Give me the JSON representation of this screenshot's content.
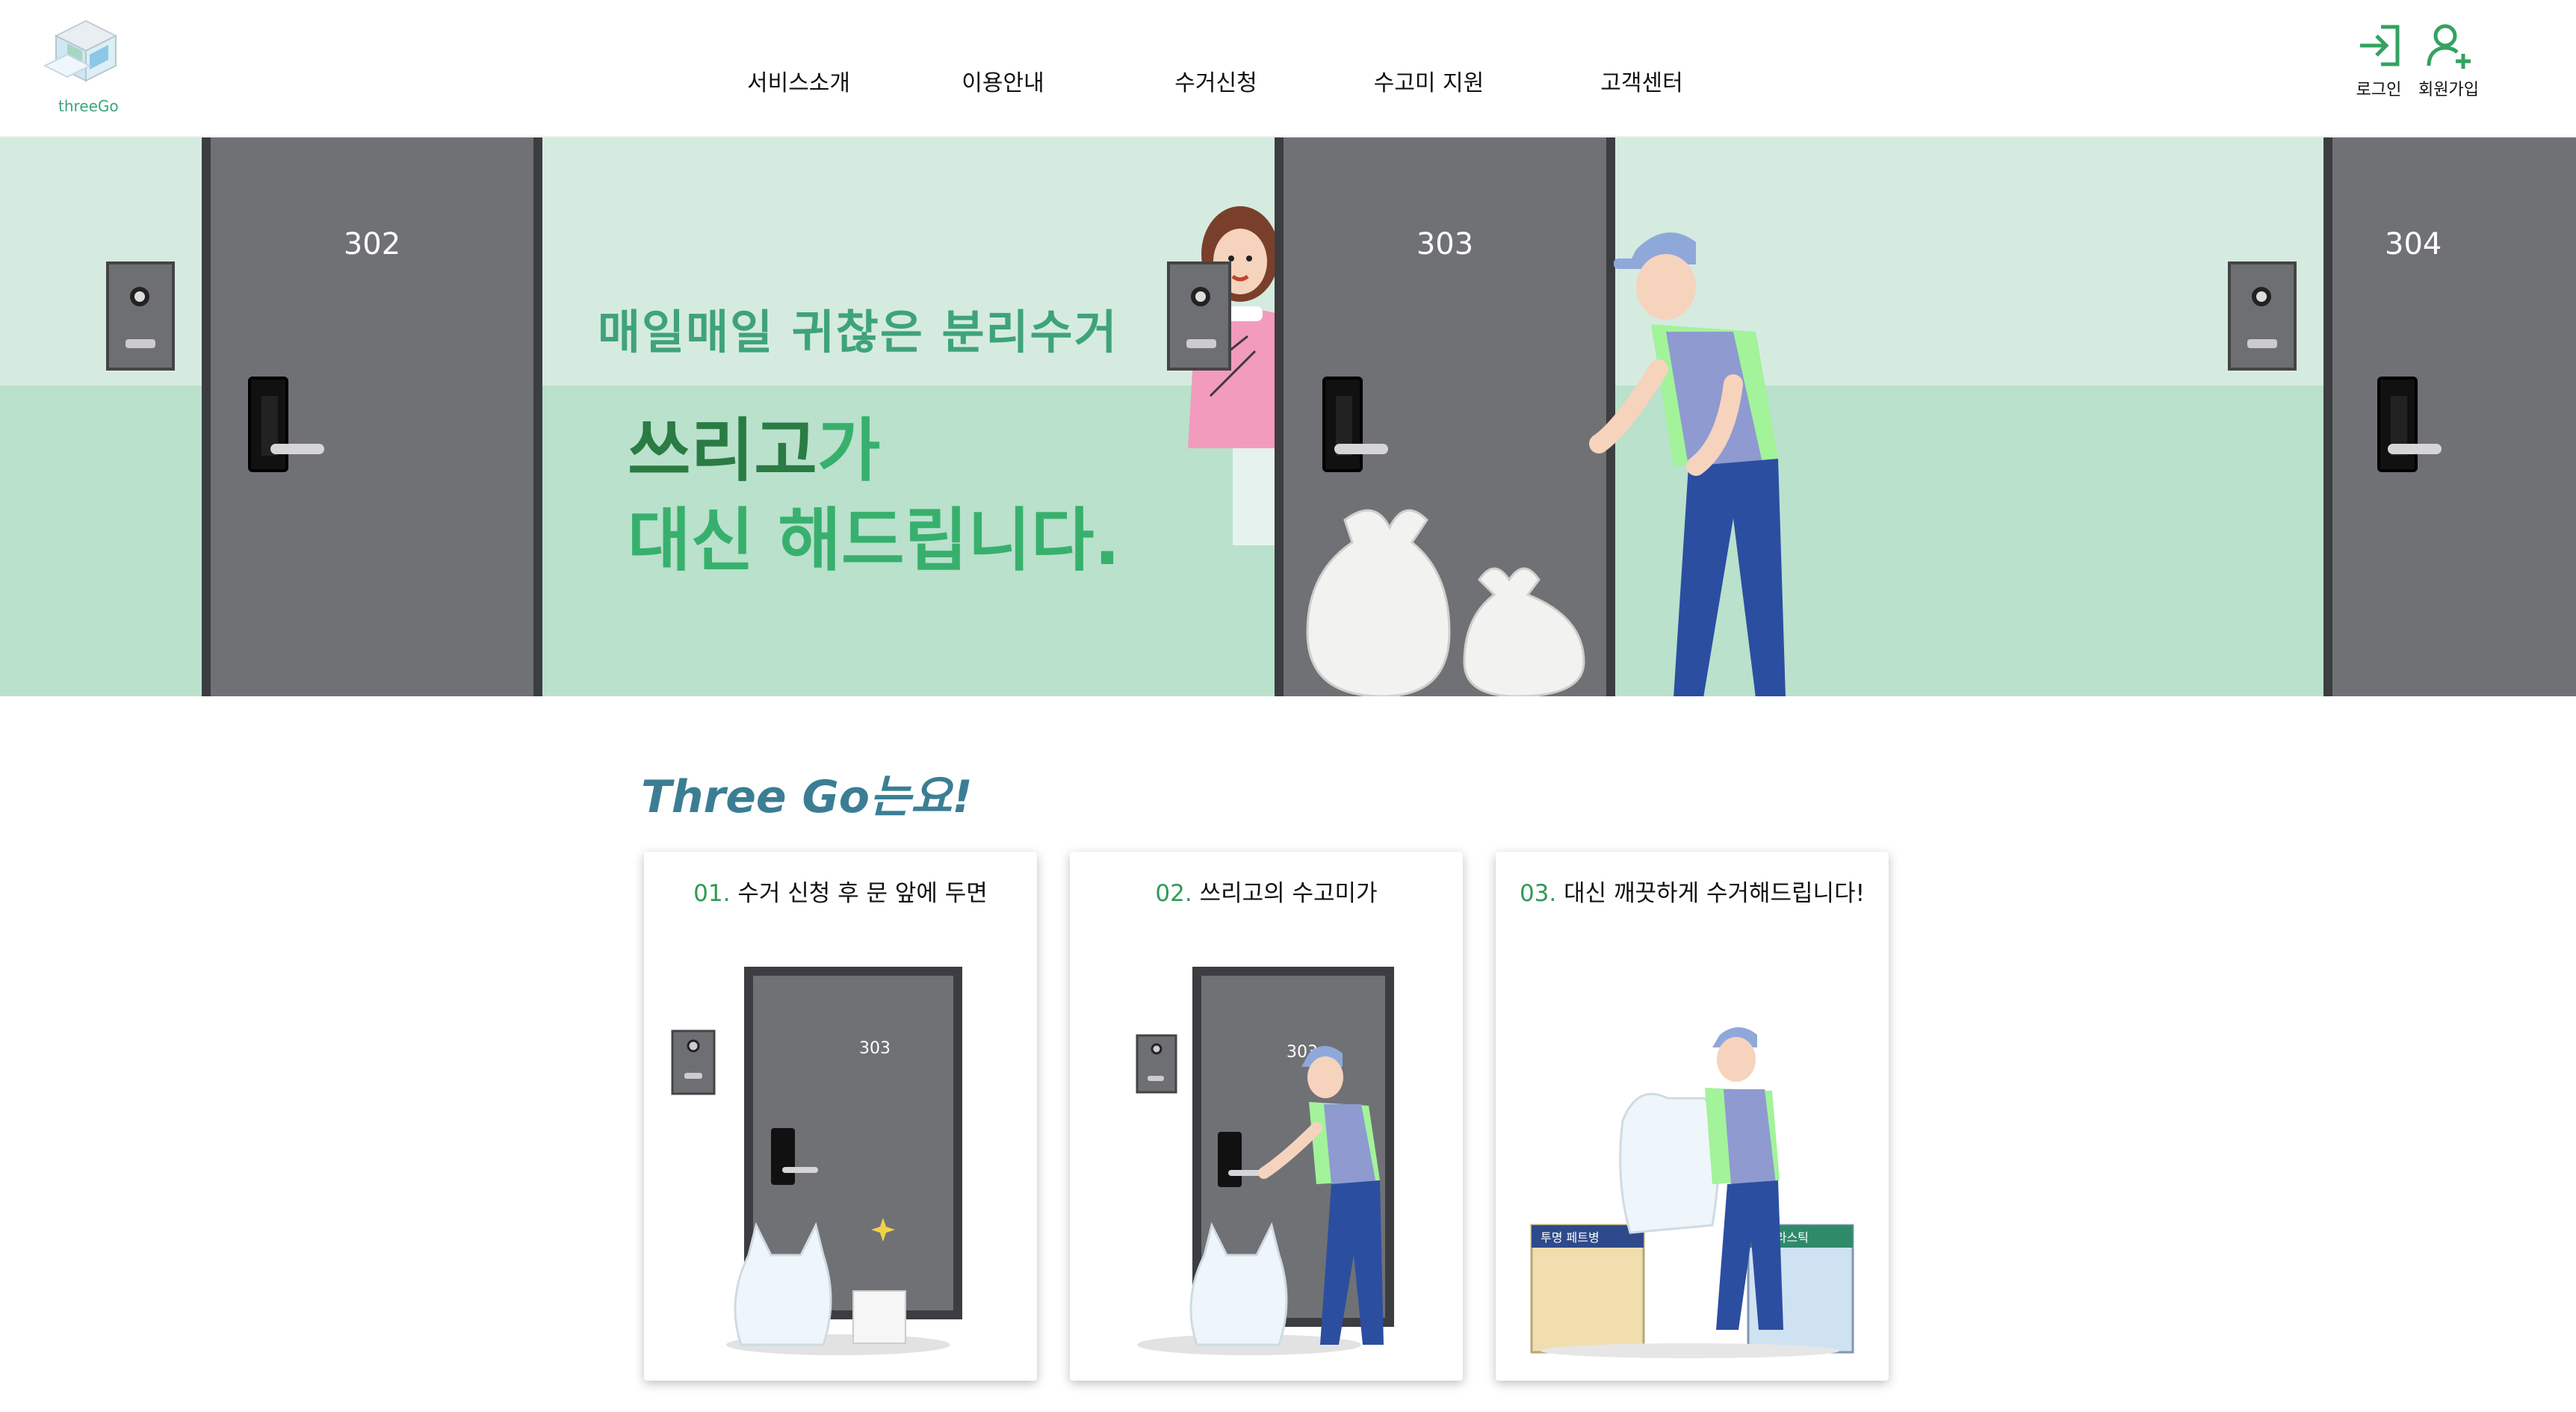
{
  "header": {
    "logo_text": "threeGo",
    "nav": [
      "서비스소개",
      "이용안내",
      "수거신청",
      "수고미 지원",
      "고객센터"
    ],
    "login_label": "로그인",
    "signup_label": "회원가입"
  },
  "hero": {
    "subtitle": "매일매일 귀찮은 분리수거",
    "title_brand": "쓰리고",
    "title_rest": "가",
    "title_line2": "대신 해드립니다.",
    "doors": [
      "302",
      "303",
      "304"
    ]
  },
  "section": {
    "title": "Three Go는요!",
    "cards": [
      {
        "num": "01.",
        "text": "수거 신청 후 문 앞에 두면",
        "door": "303"
      },
      {
        "num": "02.",
        "text": "쓰리고의 수고미가",
        "door": "303"
      },
      {
        "num": "03.",
        "text": "대신 깨끗하게 수거해드립니다!",
        "bin_left": "투명 페트병",
        "bin_right": "플라스틱"
      }
    ]
  },
  "colors": {
    "accent": "#3aa57a",
    "hero_bg": "#b9e1cc",
    "wall_top": "#d5ebe0",
    "title_blue": "#3b7e94"
  }
}
